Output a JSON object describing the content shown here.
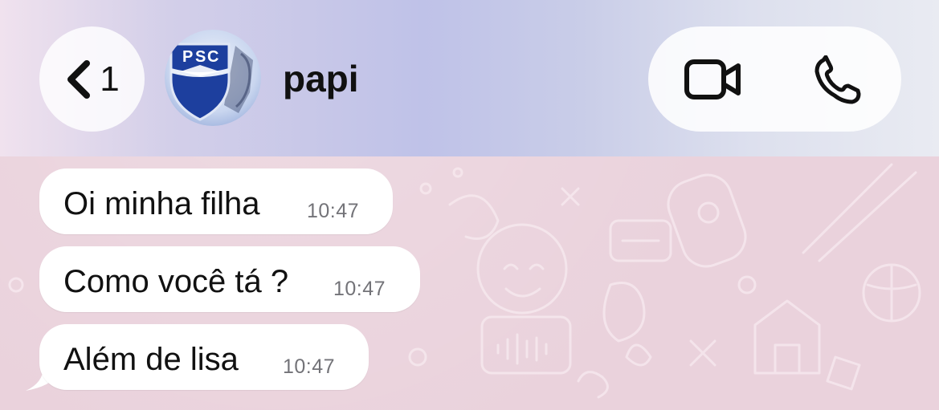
{
  "header": {
    "back_count": "1",
    "contact_name": "papi",
    "icons": {
      "back": "chevron-left-icon",
      "video": "video-camera-icon",
      "call": "phone-icon"
    }
  },
  "avatar": {
    "letters": [
      "P",
      "S",
      "C"
    ]
  },
  "messages": [
    {
      "text": "Oi minha filha",
      "time": "10:47"
    },
    {
      "text": "Como você tá ?",
      "time": "10:47"
    },
    {
      "text": "Além de lisa",
      "time": "10:47"
    }
  ],
  "colors": {
    "chat_background": "#ead2dc",
    "bubble": "#ffffff",
    "text": "#111111",
    "timestamp": "#737378"
  }
}
